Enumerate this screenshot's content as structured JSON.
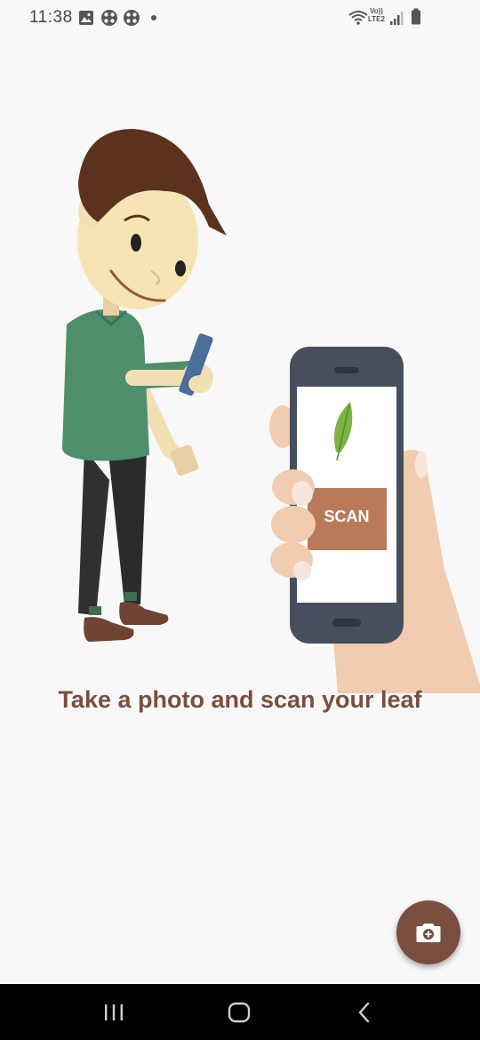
{
  "status_bar": {
    "time": "11:38",
    "left_icons": [
      "gallery-icon",
      "app-icon",
      "app-icon",
      "dot-icon"
    ],
    "network_label_top": "Vo))",
    "network_label_bottom": "LTE2",
    "right_icons": [
      "wifi-icon",
      "signal-icon",
      "battery-icon"
    ]
  },
  "illustration": {
    "phone_button_label": "SCAN"
  },
  "main": {
    "caption": "Take a photo and scan your leaf"
  },
  "fab": {
    "icon": "camera-icon",
    "color": "#7a4e3e"
  },
  "nav": {
    "recents_icon": "recents-icon",
    "home_icon": "home-icon",
    "back_icon": "back-icon"
  },
  "colors": {
    "accent": "#7a4e3e",
    "background": "#f8f8f8",
    "scan_button": "#b97a59",
    "leaf": "#8bc34a"
  }
}
